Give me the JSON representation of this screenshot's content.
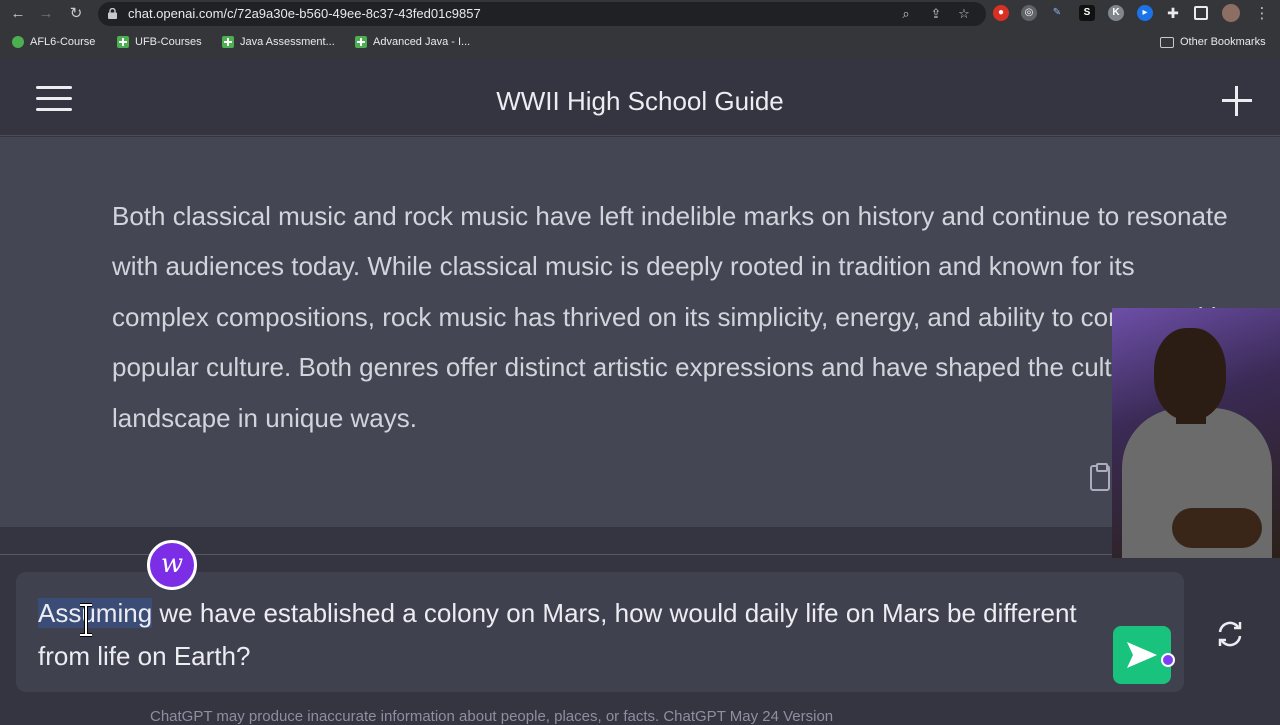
{
  "browser": {
    "url": "chat.openai.com/c/72a9a30e-b560-49ee-8c37-43fed01c9857",
    "bookmarks": [
      {
        "label": "AFL6-Course",
        "icon": "circle-icon"
      },
      {
        "label": "UFB-Courses",
        "icon": "plus-icon"
      },
      {
        "label": "Java Assessment...",
        "icon": "plus-icon"
      },
      {
        "label": "Advanced Java - I...",
        "icon": "plus-icon"
      }
    ],
    "other_bookmarks": "Other Bookmarks"
  },
  "app": {
    "title": "WWII High School Guide"
  },
  "message": {
    "text": "Both classical music and rock music have left indelible marks on history and continue to resonate with audiences today. While classical music is deeply rooted in tradition and known for its complex compositions, rock music has thrived on its simplicity, energy, and ability to connect with popular culture. Both genres offer distinct artistic expressions and have shaped the cultural landscape in unique ways."
  },
  "input": {
    "selected_word": "Assuming",
    "rest_text": " we have established a colony on Mars, how would daily life on Mars be different from life on Earth?"
  },
  "badge": {
    "letter": "w"
  },
  "footer": {
    "text": "ChatGPT may produce inaccurate information about people, places, or facts. ChatGPT May 24 Version"
  },
  "colors": {
    "send_button": "#19c37d",
    "selection": "#3b4d77",
    "badge": "#7b2ee6"
  }
}
